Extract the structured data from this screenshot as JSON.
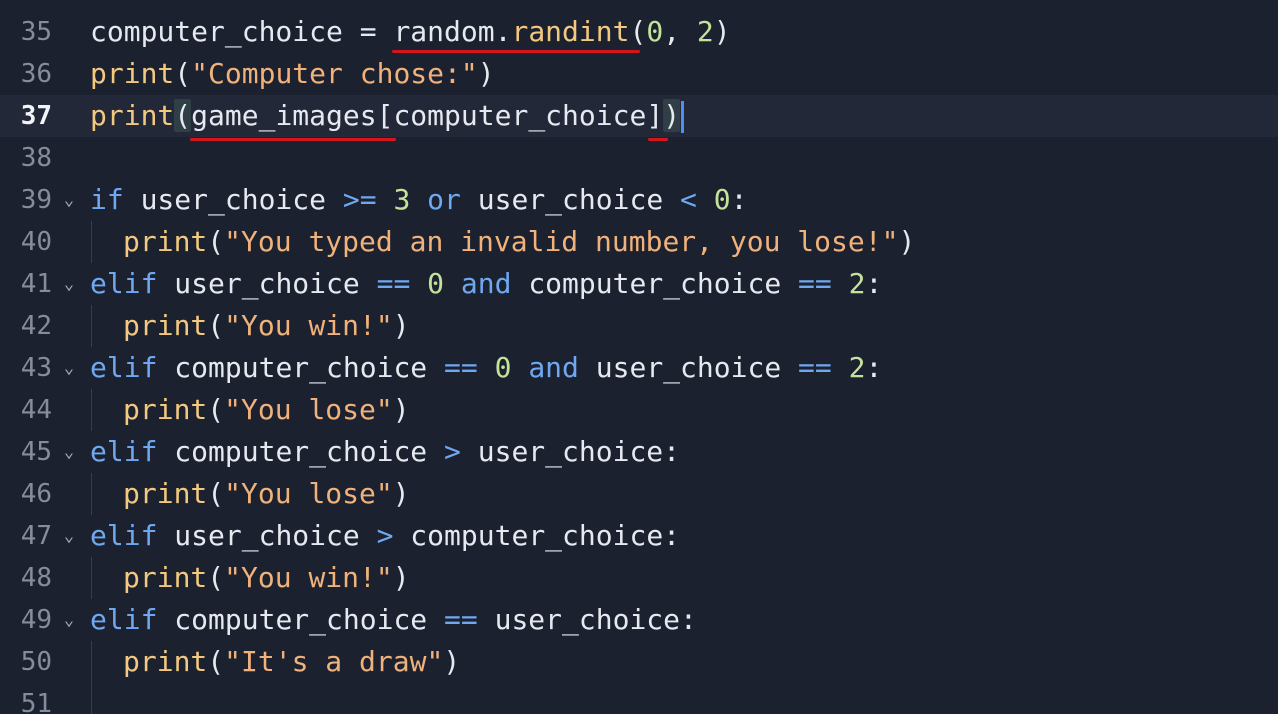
{
  "editor": {
    "lines": [
      {
        "num": "35",
        "tokens": [
          "computer_choice",
          " = ",
          "random",
          ".",
          "randint",
          "(",
          "0",
          ", ",
          "2",
          ")"
        ]
      },
      {
        "num": "36",
        "tokens": [
          "print",
          "(",
          "\"Computer chose:\"",
          ")"
        ]
      },
      {
        "num": "37",
        "tokens": [
          "print",
          "(",
          "game_images",
          "[",
          "computer_choice",
          "]",
          ")"
        ]
      },
      {
        "num": "38",
        "tokens": []
      },
      {
        "num": "39",
        "tokens": [
          "if",
          " user_choice ",
          ">=",
          " ",
          "3",
          " ",
          "or",
          " user_choice ",
          "<",
          " ",
          "0",
          ":"
        ]
      },
      {
        "num": "40",
        "tokens": [
          "print",
          "(",
          "\"You typed an invalid number, you lose!\"",
          ")"
        ]
      },
      {
        "num": "41",
        "tokens": [
          "elif",
          " user_choice ",
          "==",
          " ",
          "0",
          " ",
          "and",
          " computer_choice ",
          "==",
          " ",
          "2",
          ":"
        ]
      },
      {
        "num": "42",
        "tokens": [
          "print",
          "(",
          "\"You win!\"",
          ")"
        ]
      },
      {
        "num": "43",
        "tokens": [
          "elif",
          " computer_choice ",
          "==",
          " ",
          "0",
          " ",
          "and",
          " user_choice ",
          "==",
          " ",
          "2",
          ":"
        ]
      },
      {
        "num": "44",
        "tokens": [
          "print",
          "(",
          "\"You lose\"",
          ")"
        ]
      },
      {
        "num": "45",
        "tokens": [
          "elif",
          " computer_choice ",
          ">",
          " user_choice",
          ":"
        ]
      },
      {
        "num": "46",
        "tokens": [
          "print",
          "(",
          "\"You lose\"",
          ")"
        ]
      },
      {
        "num": "47",
        "tokens": [
          "elif",
          " user_choice ",
          ">",
          " computer_choice",
          ":"
        ]
      },
      {
        "num": "48",
        "tokens": [
          "print",
          "(",
          "\"You win!\"",
          ")"
        ]
      },
      {
        "num": "49",
        "tokens": [
          "elif",
          " computer_choice ",
          "==",
          " user_choice",
          ":"
        ]
      },
      {
        "num": "50",
        "tokens": [
          "print",
          "(",
          "\"It's a draw\"",
          ")"
        ]
      },
      {
        "num": "51",
        "tokens": []
      }
    ],
    "fold_icon": "chevron-down-icon",
    "fold_glyph": "⌄"
  },
  "colors": {
    "background": "#1c2130",
    "current_line": "#222838",
    "keyword": "#6fa8f0",
    "function": "#f2c97f",
    "string": "#f0b27a",
    "number": "#c3e29a",
    "identifier": "#e6e9ef",
    "cursor": "#4d8df5",
    "annotation_underline": "#d6141c"
  }
}
